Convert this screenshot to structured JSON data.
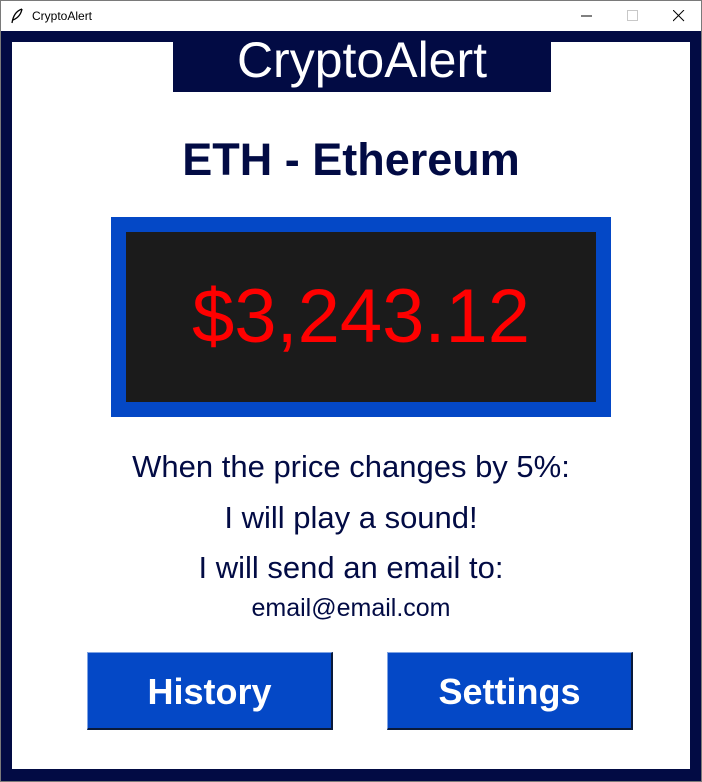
{
  "window": {
    "title": "CryptoAlert"
  },
  "banner": {
    "title": "CryptoAlert"
  },
  "coin": {
    "name": "ETH - Ethereum",
    "price": "$3,243.12"
  },
  "alert": {
    "change_text": "When the price changes by 5%:",
    "sound_text": "I will play a sound!",
    "email_text": "I will send an email to:",
    "email_address": "email@email.com"
  },
  "buttons": {
    "history_label": "History",
    "settings_label": "Settings"
  },
  "colors": {
    "navy": "#020b44",
    "blue": "#0448c6",
    "price_red": "#ff0000",
    "display_bg": "#1b1b1b"
  },
  "icons": {
    "app": "feather-icon",
    "minimize": "minimize-icon",
    "maximize": "maximize-icon",
    "close": "close-icon"
  }
}
